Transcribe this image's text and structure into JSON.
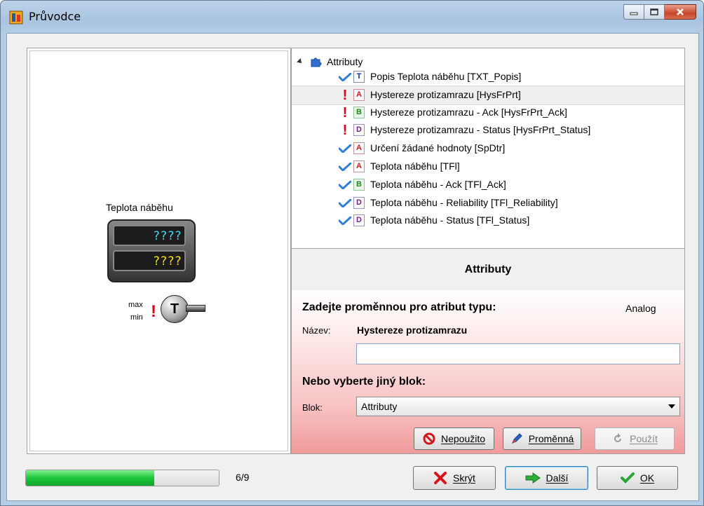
{
  "window": {
    "title": "Průvodce",
    "icon": "wizard-app-icon"
  },
  "preview": {
    "widget_label": "Teplota náběhu",
    "display_value_1": "????",
    "display_value_2": "????",
    "max_label": "max",
    "min_label": "min",
    "alarm_glyph": "!",
    "sensor_letter": "T"
  },
  "tree": {
    "root_label": "Attributy",
    "items": [
      {
        "state": "ok",
        "type": "T",
        "label": "Popis Teplota náběhu [TXT_Popis]"
      },
      {
        "state": "warn",
        "type": "A",
        "label": "Hystereze protizamrazu [HysFrPrt]",
        "selected": true
      },
      {
        "state": "warn",
        "type": "B",
        "label": "Hystereze protizamrazu - Ack [HysFrPrt_Ack]"
      },
      {
        "state": "warn",
        "type": "D",
        "label": "Hystereze protizamrazu - Status [HysFrPrt_Status]"
      },
      {
        "state": "ok",
        "type": "A",
        "label": "Určení žádané hodnoty [SpDtr]"
      },
      {
        "state": "ok",
        "type": "A",
        "label": "Teplota náběhu [TFl]"
      },
      {
        "state": "ok",
        "type": "B",
        "label": "Teplota náběhu - Ack [TFl_Ack]"
      },
      {
        "state": "ok",
        "type": "D",
        "label": "Teplota náběhu - Reliability [TFl_Reliability]"
      },
      {
        "state": "ok",
        "type": "D",
        "label": "Teplota náběhu - Status [TFl_Status]"
      }
    ]
  },
  "section": {
    "title": "Attributy"
  },
  "form": {
    "prompt": "Zadejte proměnnou pro atribut typu:",
    "attr_type": "Analog",
    "name_label": "Název:",
    "name_value": "Hystereze protizamrazu",
    "variable_value": "",
    "other_block_label": "Nebo vyberte jiný blok:",
    "block_label": "Blok:",
    "block_selected": "Attributy",
    "unused_button": "Nepoužito",
    "variable_button": "Proměnná",
    "use_button": "Použít"
  },
  "footer": {
    "progress_current": 6,
    "progress_total": 9,
    "progress_text": "6/9",
    "hide_button": "Skrýt",
    "next_button": "Další",
    "ok_button": "OK"
  },
  "colors": {
    "warn": "#e0001b",
    "check": "#2f7fd6",
    "progress": "#1ec53a"
  }
}
